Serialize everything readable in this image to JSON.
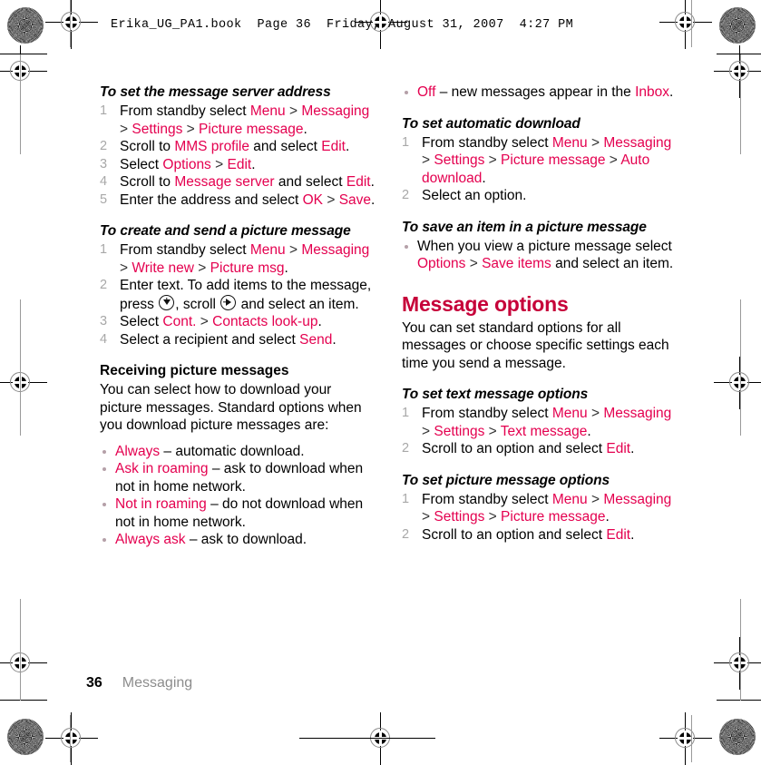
{
  "header": {
    "line": "Erika_UG_PA1.book  Page 36  Friday, August 31, 2007  4:27 PM"
  },
  "footer": {
    "page_number": "36",
    "chapter": "Messaging"
  },
  "colors": {
    "ui_term": "#E4004F",
    "section_heading": "#C60039",
    "step_number": "#a8a8a8",
    "footer_chapter": "#8c8c8c",
    "body_text": "#000000"
  },
  "left_column": {
    "task1": {
      "title": "To set the message server address",
      "steps": [
        {
          "parts": [
            {
              "t": "From standby select ",
              "s": "plain"
            },
            {
              "t": "Menu",
              "s": "ui"
            },
            {
              "t": " > ",
              "s": "gt"
            },
            {
              "t": "Messaging",
              "s": "ui"
            },
            {
              "t": " > ",
              "s": "gt"
            },
            {
              "t": "Settings",
              "s": "ui"
            },
            {
              "t": " > ",
              "s": "gt"
            },
            {
              "t": "Picture message",
              "s": "ui"
            },
            {
              "t": ".",
              "s": "plain"
            }
          ]
        },
        {
          "parts": [
            {
              "t": "Scroll to ",
              "s": "plain"
            },
            {
              "t": "MMS profile",
              "s": "ui"
            },
            {
              "t": " and select ",
              "s": "plain"
            },
            {
              "t": "Edit",
              "s": "ui"
            },
            {
              "t": ".",
              "s": "plain"
            }
          ]
        },
        {
          "parts": [
            {
              "t": "Select ",
              "s": "plain"
            },
            {
              "t": "Options",
              "s": "ui"
            },
            {
              "t": " > ",
              "s": "gt"
            },
            {
              "t": "Edit",
              "s": "ui"
            },
            {
              "t": ".",
              "s": "plain"
            }
          ]
        },
        {
          "parts": [
            {
              "t": "Scroll to ",
              "s": "plain"
            },
            {
              "t": "Message server",
              "s": "ui"
            },
            {
              "t": " and select ",
              "s": "plain"
            },
            {
              "t": "Edit",
              "s": "ui"
            },
            {
              "t": ".",
              "s": "plain"
            }
          ]
        },
        {
          "parts": [
            {
              "t": "Enter the address and select ",
              "s": "plain"
            },
            {
              "t": "OK",
              "s": "ui"
            },
            {
              "t": " > ",
              "s": "gt"
            },
            {
              "t": "Save",
              "s": "ui"
            },
            {
              "t": ".",
              "s": "plain"
            }
          ]
        }
      ]
    },
    "task2": {
      "title": "To create and send a picture message",
      "steps": [
        {
          "parts": [
            {
              "t": "From standby select ",
              "s": "plain"
            },
            {
              "t": "Menu",
              "s": "ui"
            },
            {
              "t": " > ",
              "s": "gt"
            },
            {
              "t": "Messaging",
              "s": "ui"
            },
            {
              "t": " > ",
              "s": "gt"
            },
            {
              "t": "Write new",
              "s": "ui"
            },
            {
              "t": " > ",
              "s": "gt"
            },
            {
              "t": "Picture msg",
              "s": "ui"
            },
            {
              "t": ".",
              "s": "plain"
            }
          ]
        },
        {
          "parts": [
            {
              "t": "Enter text. To add items to the message, press ",
              "s": "plain"
            },
            {
              "t": "",
              "s": "icon-navkey-down"
            },
            {
              "t": ", scroll ",
              "s": "plain"
            },
            {
              "t": "",
              "s": "icon-navkey-right"
            },
            {
              "t": " and select an item.",
              "s": "plain"
            }
          ]
        },
        {
          "parts": [
            {
              "t": "Select ",
              "s": "plain"
            },
            {
              "t": "Cont.",
              "s": "ui"
            },
            {
              "t": " > ",
              "s": "gt"
            },
            {
              "t": "Contacts look-up",
              "s": "ui"
            },
            {
              "t": ".",
              "s": "plain"
            }
          ]
        },
        {
          "parts": [
            {
              "t": "Select a recipient and select ",
              "s": "plain"
            },
            {
              "t": "Send",
              "s": "ui"
            },
            {
              "t": ".",
              "s": "plain"
            }
          ]
        }
      ]
    },
    "subsection": {
      "title": "Receiving picture messages",
      "body": "You can select how to download your picture messages. Standard options when you download picture messages are:",
      "bullets": [
        {
          "parts": [
            {
              "t": "Always",
              "s": "ui"
            },
            {
              "t": " – automatic download.",
              "s": "plain"
            }
          ]
        },
        {
          "parts": [
            {
              "t": "Ask in roaming",
              "s": "ui"
            },
            {
              "t": " – ask to download when not in home network.",
              "s": "plain"
            }
          ]
        },
        {
          "parts": [
            {
              "t": "Not in roaming",
              "s": "ui"
            },
            {
              "t": " – do not download when not in home network.",
              "s": "plain"
            }
          ]
        },
        {
          "parts": [
            {
              "t": "Always ask",
              "s": "ui"
            },
            {
              "t": " – ask to download.",
              "s": "plain"
            }
          ]
        }
      ]
    }
  },
  "right_column": {
    "continued_bullets": [
      {
        "parts": [
          {
            "t": "Off",
            "s": "ui"
          },
          {
            "t": " – new messages appear in the ",
            "s": "plain"
          },
          {
            "t": "Inbox",
            "s": "ui"
          },
          {
            "t": ".",
            "s": "plain"
          }
        ]
      }
    ],
    "task3": {
      "title": "To set automatic download",
      "steps": [
        {
          "parts": [
            {
              "t": "From standby select ",
              "s": "plain"
            },
            {
              "t": "Menu",
              "s": "ui"
            },
            {
              "t": " > ",
              "s": "gt"
            },
            {
              "t": "Messaging",
              "s": "ui"
            },
            {
              "t": " > ",
              "s": "gt"
            },
            {
              "t": "Settings",
              "s": "ui"
            },
            {
              "t": " > ",
              "s": "gt"
            },
            {
              "t": "Picture message",
              "s": "ui"
            },
            {
              "t": " > ",
              "s": "gt"
            },
            {
              "t": "Auto download",
              "s": "ui"
            },
            {
              "t": ".",
              "s": "plain"
            }
          ]
        },
        {
          "parts": [
            {
              "t": "Select an option.",
              "s": "plain"
            }
          ]
        }
      ]
    },
    "task4": {
      "title": "To save an item in a picture message",
      "bullets": [
        {
          "parts": [
            {
              "t": "When you view a picture message select ",
              "s": "plain"
            },
            {
              "t": "Options",
              "s": "ui"
            },
            {
              "t": " > ",
              "s": "gt"
            },
            {
              "t": "Save items",
              "s": "ui"
            },
            {
              "t": " and select an item.",
              "s": "plain"
            }
          ]
        }
      ]
    },
    "section": {
      "heading": "Message options",
      "body": "You can set standard options for all messages or choose specific settings each time you send a message."
    },
    "task5": {
      "title": "To set text message options",
      "steps": [
        {
          "parts": [
            {
              "t": "From standby select ",
              "s": "plain"
            },
            {
              "t": "Menu",
              "s": "ui"
            },
            {
              "t": " > ",
              "s": "gt"
            },
            {
              "t": "Messaging",
              "s": "ui"
            },
            {
              "t": " > ",
              "s": "gt"
            },
            {
              "t": "Settings",
              "s": "ui"
            },
            {
              "t": " > ",
              "s": "gt"
            },
            {
              "t": "Text message",
              "s": "ui"
            },
            {
              "t": ".",
              "s": "plain"
            }
          ]
        },
        {
          "parts": [
            {
              "t": "Scroll to an option and select ",
              "s": "plain"
            },
            {
              "t": "Edit",
              "s": "ui"
            },
            {
              "t": ".",
              "s": "plain"
            }
          ]
        }
      ]
    },
    "task6": {
      "title": "To set picture message options",
      "steps": [
        {
          "parts": [
            {
              "t": "From standby select ",
              "s": "plain"
            },
            {
              "t": "Menu",
              "s": "ui"
            },
            {
              "t": " > ",
              "s": "gt"
            },
            {
              "t": "Messaging",
              "s": "ui"
            },
            {
              "t": " > ",
              "s": "gt"
            },
            {
              "t": "Settings",
              "s": "ui"
            },
            {
              "t": " > ",
              "s": "gt"
            },
            {
              "t": "Picture message",
              "s": "ui"
            },
            {
              "t": ".",
              "s": "plain"
            }
          ]
        },
        {
          "parts": [
            {
              "t": "Scroll to an option and select ",
              "s": "plain"
            },
            {
              "t": "Edit",
              "s": "ui"
            },
            {
              "t": ".",
              "s": "plain"
            }
          ]
        }
      ]
    }
  }
}
